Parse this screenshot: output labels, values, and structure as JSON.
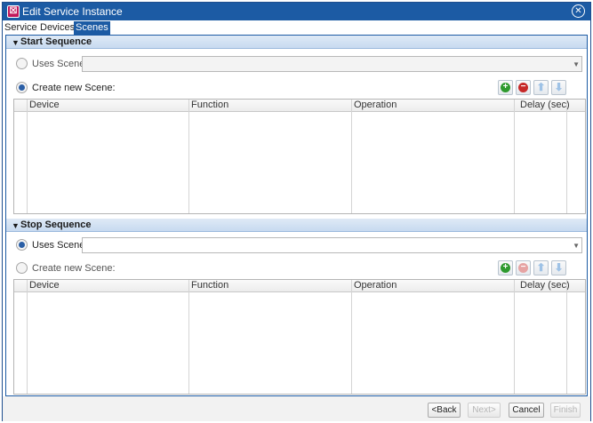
{
  "window": {
    "title": "Edit Service Instance",
    "app_icon_glyph": "☒",
    "close_glyph": "✕"
  },
  "tabs": [
    {
      "label": "Service",
      "active": false
    },
    {
      "label": "Devices",
      "active": false
    },
    {
      "label": "Scenes",
      "active": true
    }
  ],
  "start_sequence": {
    "title": "Start Sequence",
    "uses_scene_label": "Uses Scene:",
    "uses_scene_selected": false,
    "uses_scene_value": "",
    "create_new_label": "Create new Scene:",
    "create_new_selected": true,
    "columns": [
      "Device",
      "Function",
      "Operation",
      "Delay (sec)"
    ],
    "rows": []
  },
  "stop_sequence": {
    "title": "Stop Sequence",
    "uses_scene_label": "Uses Scene:",
    "uses_scene_selected": true,
    "uses_scene_value": "",
    "create_new_label": "Create new Scene:",
    "create_new_selected": false,
    "columns": [
      "Device",
      "Function",
      "Operation",
      "Delay (sec)"
    ],
    "rows": []
  },
  "toolbar_icons": {
    "add": "+",
    "remove": "−",
    "up": "⬆",
    "down": "⬇"
  },
  "footer": {
    "back": "<Back",
    "next": "Next>",
    "cancel": "Cancel",
    "finish": "Finish"
  },
  "colors": {
    "title_bar": "#1c5ba4",
    "section_header": "#c7daf0",
    "add_green": "#2e9a2e",
    "remove_red": "#c62828"
  }
}
